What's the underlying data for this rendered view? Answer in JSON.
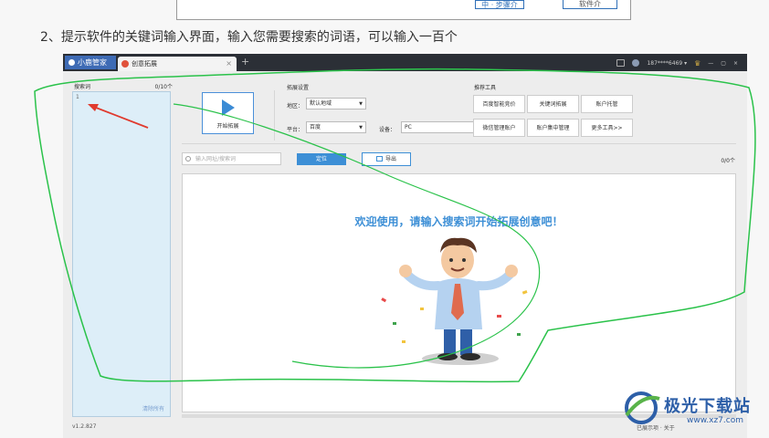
{
  "caption": "2、提示软件的关键词输入界面，输入您需要搜索的词语，可以输入一百个",
  "top_fragment": {
    "btn1": "中 · 步骤介",
    "btn2": "软件介"
  },
  "app": {
    "logo": "小鹿管家",
    "tab_label": "创意拓展",
    "tab_close": "×",
    "tab_add": "+",
    "user": "187****6469 ▾"
  },
  "left_panel": {
    "title": "搜索词",
    "count": "0/10个",
    "line_number": "1",
    "clear": "清除所有"
  },
  "version": "v1.2.827",
  "start_button": {
    "label": "开始拓展"
  },
  "settings": {
    "title": "拓展设置",
    "region_label": "地区：",
    "region_value": "默认地域",
    "platform_label": "平台：",
    "platform_value": "百度",
    "device_label": "设备：",
    "device_value": "PC"
  },
  "tools": {
    "title": "推荐工具",
    "items": [
      "百度智能竞价",
      "关键词拓展",
      "账户托管",
      "微信管理账户",
      "账户集中管理",
      "更多工具>>"
    ]
  },
  "search": {
    "placeholder": "输入网址/搜索词"
  },
  "locate_button": "定位",
  "export_button": "导出",
  "result_count": "0/0个",
  "welcome": "欢迎使用，请输入搜索词开始拓展创意吧！",
  "status_right": "已展示项 · 关于",
  "watermark": {
    "title": "极光下载站",
    "url": "www.xz7.com"
  },
  "colors": {
    "accent": "#3d8fd6",
    "highlight": "#2ac24a",
    "arrow": "#e03a2e",
    "titlebar": "#2b2f36"
  }
}
